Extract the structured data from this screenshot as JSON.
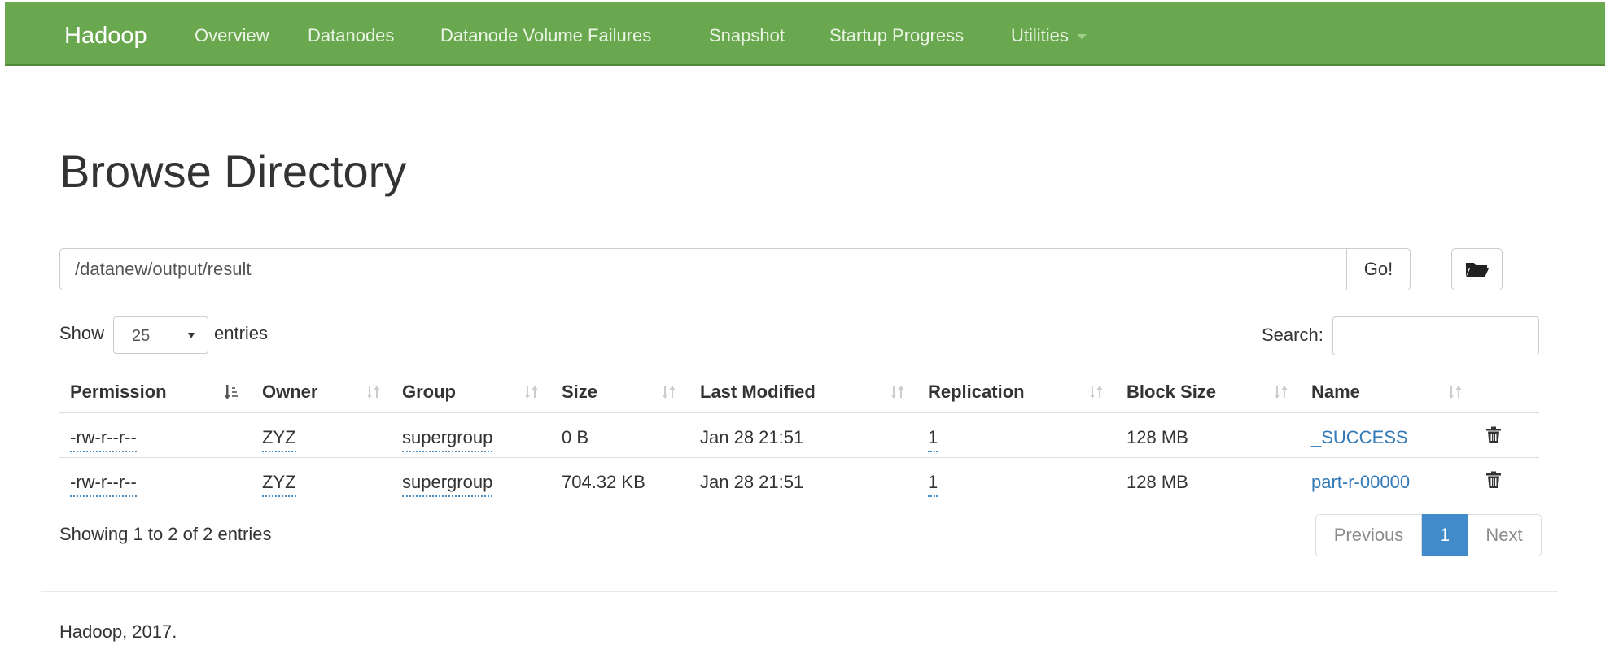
{
  "navbar": {
    "brand": "Hadoop",
    "items": [
      "Overview",
      "Datanodes",
      "Datanode Volume Failures",
      "Snapshot",
      "Startup Progress",
      "Utilities"
    ]
  },
  "page": {
    "title": "Browse Directory",
    "path_value": "/datanew/output/result",
    "go_label": "Go!",
    "folder_icon": "folder-open-icon"
  },
  "controls": {
    "show_label": "Show",
    "length_value": "25",
    "entries_label": "entries",
    "search_label": "Search:",
    "search_value": ""
  },
  "table": {
    "headers": [
      "Permission",
      "Owner",
      "Group",
      "Size",
      "Last Modified",
      "Replication",
      "Block Size",
      "Name"
    ],
    "sort_active": "Permission",
    "rows": [
      {
        "permission": "-rw-r--r--",
        "owner": "ZYZ",
        "group": "supergroup",
        "size": "0 B",
        "modified": "Jan 28 21:51",
        "replication": "1",
        "block_size": "128 MB",
        "name": "_SUCCESS"
      },
      {
        "permission": "-rw-r--r--",
        "owner": "ZYZ",
        "group": "supergroup",
        "size": "704.32 KB",
        "modified": "Jan 28 21:51",
        "replication": "1",
        "block_size": "128 MB",
        "name": "part-r-00000"
      }
    ],
    "delete_icon": "trash-icon"
  },
  "pagination": {
    "info": "Showing 1 to 2 of 2 entries",
    "previous": "Previous",
    "current": "1",
    "next": "Next"
  },
  "footer": {
    "text": "Hadoop, 2017."
  },
  "colors": {
    "navbar": "#6aa84f",
    "link": "#337ab7",
    "active_page": "#428bca"
  }
}
